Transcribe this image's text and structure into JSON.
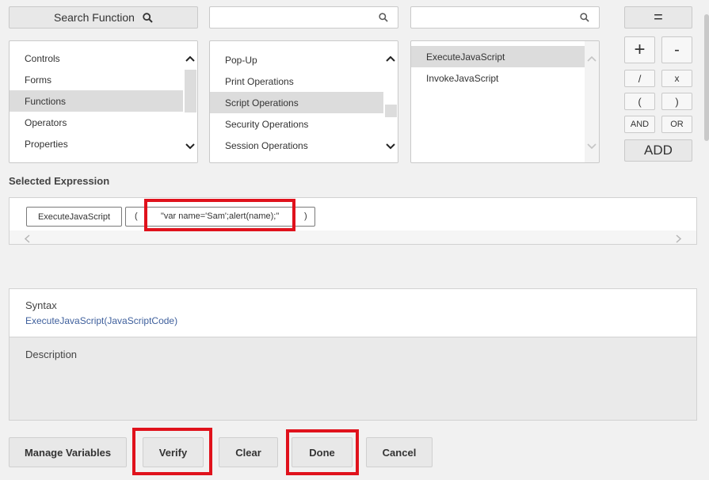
{
  "search": {
    "button_label": "Search Function",
    "field1_value": "",
    "field2_value": ""
  },
  "categories": {
    "items": [
      "Controls",
      "Forms",
      "Functions",
      "Operators",
      "Properties"
    ],
    "selected": "Functions"
  },
  "subcategories": {
    "items": [
      "Pop-Up",
      "Print Operations",
      "Script Operations",
      "Security Operations",
      "Session Operations"
    ],
    "selected": "Script Operations"
  },
  "functions": {
    "items": [
      "ExecuteJavaScript",
      "InvokeJavaScript"
    ],
    "selected": "ExecuteJavaScript"
  },
  "operators": {
    "equals": "=",
    "plus": "+",
    "minus": "-",
    "divide": "/",
    "multiply": "x",
    "open_paren": "(",
    "close_paren": ")",
    "and": "AND",
    "or": "OR",
    "add": "ADD"
  },
  "expression": {
    "heading": "Selected Expression",
    "function_token": "ExecuteJavaScript",
    "open_paren": "(",
    "argument": "\"var name='Sam';alert(name);\"",
    "close_paren": ")"
  },
  "syntax": {
    "heading": "Syntax",
    "signature": "ExecuteJavaScript(JavaScriptCode)"
  },
  "description": {
    "heading": "Description"
  },
  "actions": {
    "manage_variables": "Manage Variables",
    "verify": "Verify",
    "clear": "Clear",
    "done": "Done",
    "cancel": "Cancel"
  },
  "colors": {
    "highlight": "#e0121c",
    "link_blue": "#3e5f9c",
    "selection": "#dcdcdc"
  }
}
